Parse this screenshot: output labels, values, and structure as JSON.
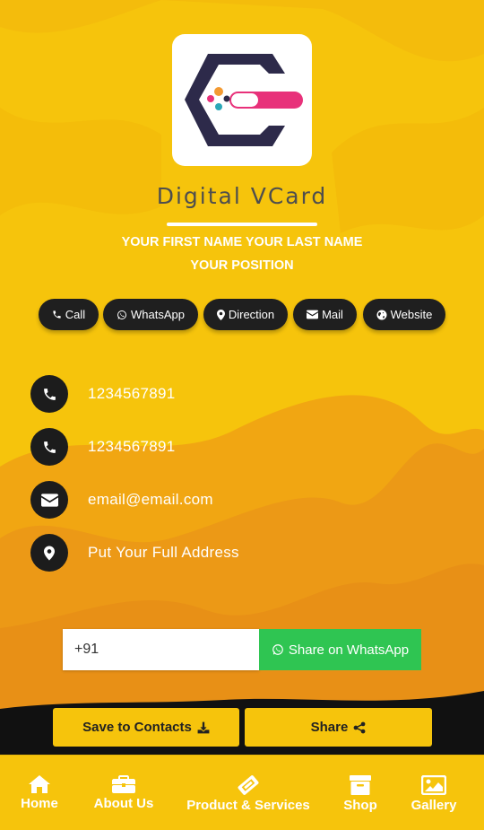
{
  "brand": {
    "title": "Digital VCard"
  },
  "profile": {
    "name": "YOUR FIRST NAME YOUR LAST NAME",
    "position": "YOUR POSITION"
  },
  "actions": [
    {
      "label": "Call",
      "icon": "phone-icon"
    },
    {
      "label": "WhatsApp",
      "icon": "whatsapp-icon"
    },
    {
      "label": "Direction",
      "icon": "map-marker-icon"
    },
    {
      "label": "Mail",
      "icon": "envelope-icon"
    },
    {
      "label": "Website",
      "icon": "globe-icon"
    }
  ],
  "contacts": [
    {
      "icon": "phone-icon",
      "value": "1234567891"
    },
    {
      "icon": "phone-icon",
      "value": "1234567891"
    },
    {
      "icon": "envelope-icon",
      "value": "email@email.com"
    },
    {
      "icon": "map-marker-icon",
      "value": "Put Your Full Address"
    }
  ],
  "whatsapp_share": {
    "input_value": "+91",
    "button_label": "Share on WhatsApp"
  },
  "buttons": {
    "save_label": "Save to Contacts",
    "share_label": "Share"
  },
  "nav": [
    {
      "label": "Home",
      "icon": "home-icon"
    },
    {
      "label": "About Us",
      "icon": "briefcase-icon"
    },
    {
      "label": "Product & Services",
      "icon": "ticket-icon"
    },
    {
      "label": "Shop",
      "icon": "archive-box-icon"
    },
    {
      "label": "Gallery",
      "icon": "image-icon"
    }
  ],
  "colors": {
    "background": "#f6c40c",
    "accent_dark": "#1c1c1c",
    "whatsapp_green": "#2fc552",
    "logo_purple": "#2d2a4a",
    "logo_pink": "#e8317a"
  }
}
